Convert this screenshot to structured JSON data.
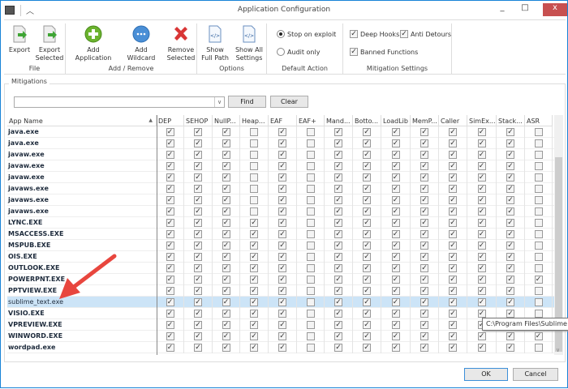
{
  "window": {
    "title": "Application Configuration",
    "minimize": "_",
    "maximize": "□",
    "close": "x"
  },
  "ribbon": {
    "groups": [
      {
        "label": "File",
        "buttons": [
          {
            "label": "Export",
            "icon": "export-icon"
          },
          {
            "label": "Export Selected",
            "icon": "export-selected-icon"
          }
        ]
      },
      {
        "label": "Add / Remove",
        "buttons": [
          {
            "label": "Add Application",
            "icon": "add-icon"
          },
          {
            "label": "Add Wildcard",
            "icon": "wildcard-icon"
          },
          {
            "label": "Remove Selected",
            "icon": "remove-icon"
          }
        ]
      },
      {
        "label": "Options",
        "buttons": [
          {
            "label": "Show Full Path",
            "icon": "code-file-icon"
          },
          {
            "label": "Show All Settings",
            "icon": "code-file-icon"
          }
        ]
      }
    ],
    "default_action": {
      "label": "Default Action",
      "stop": "Stop on exploit",
      "audit": "Audit only",
      "selected": "Stop on exploit"
    },
    "mitigation_settings": {
      "label": "Mitigation Settings",
      "deep_hooks": "Deep Hooks",
      "anti_detours": "Anti Detours",
      "banned_functions": "Banned Functions",
      "deep_hooks_checked": true,
      "anti_detours_checked": true,
      "banned_functions_checked": true
    }
  },
  "mitigations": {
    "label": "Mitigations",
    "search_value": "",
    "find": "Find",
    "clear": "Clear"
  },
  "table": {
    "columns": [
      "App Name",
      "DEP",
      "SEHOP",
      "NullP...",
      "Heap...",
      "EAF",
      "EAF+",
      "Mand...",
      "Botto...",
      "LoadLib",
      "MemP...",
      "Caller",
      "SimEx...",
      "Stack...",
      "ASR"
    ],
    "sort_column": "App Name",
    "selected_row": "sublime_text.exe",
    "rows": [
      {
        "name": "java.exe",
        "checks": [
          1,
          1,
          1,
          0,
          1,
          0,
          1,
          1,
          1,
          1,
          1,
          1,
          1,
          0
        ]
      },
      {
        "name": "java.exe",
        "checks": [
          1,
          1,
          1,
          0,
          1,
          0,
          1,
          1,
          1,
          1,
          1,
          1,
          1,
          0
        ]
      },
      {
        "name": "javaw.exe",
        "checks": [
          1,
          1,
          1,
          0,
          1,
          0,
          1,
          1,
          1,
          1,
          1,
          1,
          1,
          0
        ]
      },
      {
        "name": "javaw.exe",
        "checks": [
          1,
          1,
          1,
          0,
          1,
          0,
          1,
          1,
          1,
          1,
          1,
          1,
          1,
          0
        ]
      },
      {
        "name": "javaw.exe",
        "checks": [
          1,
          1,
          1,
          0,
          1,
          0,
          1,
          1,
          1,
          1,
          1,
          1,
          1,
          0
        ]
      },
      {
        "name": "javaws.exe",
        "checks": [
          1,
          1,
          1,
          0,
          1,
          0,
          1,
          1,
          1,
          1,
          1,
          1,
          1,
          0
        ]
      },
      {
        "name": "javaws.exe",
        "checks": [
          1,
          1,
          1,
          0,
          1,
          0,
          1,
          1,
          1,
          1,
          1,
          1,
          1,
          0
        ]
      },
      {
        "name": "javaws.exe",
        "checks": [
          1,
          1,
          1,
          0,
          1,
          0,
          1,
          1,
          1,
          1,
          1,
          1,
          1,
          0
        ]
      },
      {
        "name": "LYNC.EXE",
        "checks": [
          1,
          1,
          1,
          1,
          1,
          0,
          1,
          1,
          1,
          1,
          1,
          1,
          1,
          0
        ]
      },
      {
        "name": "MSACCESS.EXE",
        "checks": [
          1,
          1,
          1,
          1,
          1,
          0,
          1,
          1,
          1,
          1,
          1,
          1,
          1,
          0
        ]
      },
      {
        "name": "MSPUB.EXE",
        "checks": [
          1,
          1,
          1,
          1,
          1,
          0,
          1,
          1,
          1,
          1,
          1,
          1,
          1,
          0
        ]
      },
      {
        "name": "OIS.EXE",
        "checks": [
          1,
          1,
          1,
          1,
          1,
          0,
          1,
          1,
          1,
          1,
          1,
          1,
          1,
          0
        ]
      },
      {
        "name": "OUTLOOK.EXE",
        "checks": [
          1,
          1,
          1,
          1,
          1,
          0,
          1,
          1,
          1,
          1,
          1,
          1,
          1,
          0
        ]
      },
      {
        "name": "POWERPNT.EXE",
        "checks": [
          1,
          1,
          1,
          1,
          1,
          0,
          1,
          1,
          1,
          1,
          1,
          1,
          1,
          1
        ]
      },
      {
        "name": "PPTVIEW.EXE",
        "checks": [
          1,
          1,
          1,
          1,
          1,
          0,
          1,
          1,
          1,
          1,
          1,
          1,
          1,
          0
        ]
      },
      {
        "name": "sublime_text.exe",
        "checks": [
          1,
          1,
          1,
          1,
          1,
          0,
          1,
          1,
          1,
          1,
          1,
          1,
          1,
          0
        ]
      },
      {
        "name": "VISIO.EXE",
        "checks": [
          1,
          1,
          1,
          1,
          1,
          0,
          1,
          1,
          1,
          1,
          1,
          1,
          1,
          0
        ]
      },
      {
        "name": "VPREVIEW.EXE",
        "checks": [
          1,
          1,
          1,
          1,
          1,
          0,
          1,
          1,
          1,
          1,
          1,
          1,
          1,
          0
        ]
      },
      {
        "name": "WINWORD.EXE",
        "checks": [
          1,
          1,
          1,
          1,
          1,
          0,
          1,
          1,
          1,
          1,
          1,
          1,
          1,
          1
        ]
      },
      {
        "name": "wordpad.exe",
        "checks": [
          1,
          1,
          1,
          1,
          1,
          0,
          1,
          1,
          1,
          1,
          1,
          1,
          1,
          0
        ]
      }
    ]
  },
  "tooltip": "C:\\Program Files\\Sublime Tex",
  "footer": {
    "ok": "OK",
    "cancel": "Cancel"
  },
  "colors": {
    "selection": "#cce4f7",
    "arrow": "#e8463e",
    "close": "#c75050"
  }
}
